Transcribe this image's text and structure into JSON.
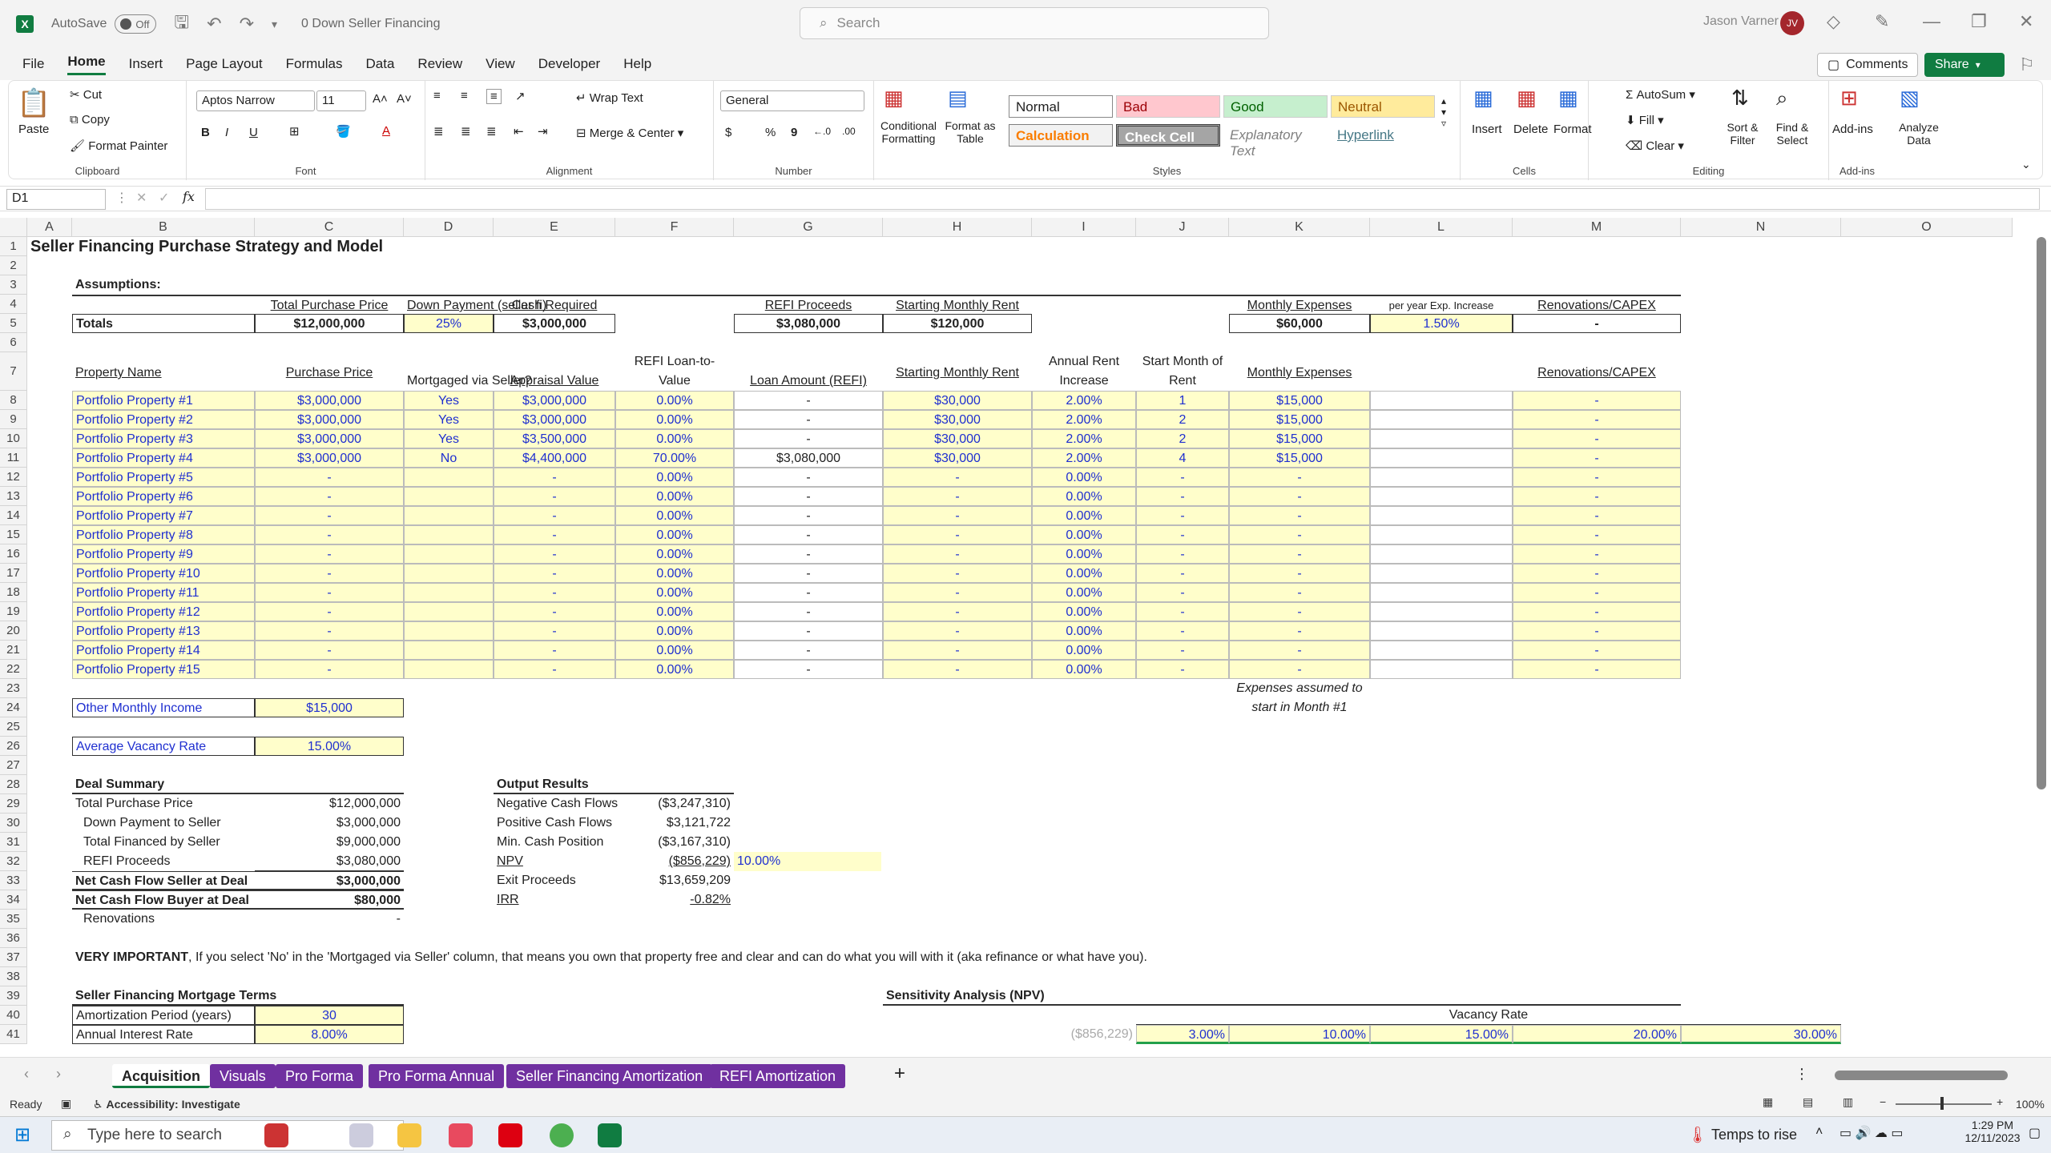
{
  "titlebar": {
    "autosave": "AutoSave",
    "autosave_state": "Off",
    "doc_title": "0 Down Seller Financing",
    "search_placeholder": "Search",
    "user": "Jason Varner",
    "initials": "JV"
  },
  "menu": [
    "File",
    "Home",
    "Insert",
    "Page Layout",
    "Formulas",
    "Data",
    "Review",
    "View",
    "Developer",
    "Help"
  ],
  "menu_right": {
    "comments": "Comments",
    "share": "Share"
  },
  "ribbon": {
    "clipboard": {
      "paste": "Paste",
      "cut": "Cut",
      "copy": "Copy",
      "format_painter": "Format Painter",
      "label": "Clipboard"
    },
    "font": {
      "name": "Aptos Narrow",
      "size": "11",
      "label": "Font",
      "b": "B",
      "i": "I",
      "u": "U"
    },
    "alignment": {
      "wrap": "Wrap Text",
      "merge": "Merge & Center",
      "label": "Alignment"
    },
    "number": {
      "format": "General",
      "label": "Number",
      "currency": "$",
      "pct": "%",
      "comma": "9"
    },
    "styles": {
      "conditional": "Conditional Formatting",
      "format_table": "Format as Table",
      "normal": "Normal",
      "bad": "Bad",
      "good": "Good",
      "neutral": "Neutral",
      "calculation": "Calculation",
      "check_cell": "Check Cell",
      "explanatory": "Explanatory Text",
      "hyperlink": "Hyperlink",
      "label": "Styles"
    },
    "cells": {
      "insert": "Insert",
      "delete": "Delete",
      "format": "Format",
      "label": "Cells"
    },
    "editing": {
      "autosum": "AutoSum",
      "fill": "Fill",
      "clear": "Clear",
      "sort": "Sort & Filter",
      "find": "Find & Select",
      "label": "Editing"
    },
    "addins": {
      "addins": "Add-ins",
      "analyze": "Analyze Data",
      "label": "Add-ins"
    }
  },
  "formula": {
    "namebox": "D1",
    "fx": "fx"
  },
  "columns": [
    "A",
    "B",
    "C",
    "D",
    "E",
    "F",
    "G",
    "H",
    "I",
    "J",
    "K",
    "L",
    "M",
    "N",
    "O"
  ],
  "rows": [
    "1",
    "2",
    "3",
    "4",
    "5",
    "6",
    "7",
    "8",
    "9",
    "10",
    "11",
    "12",
    "13",
    "14",
    "15",
    "16",
    "17",
    "18",
    "19",
    "20",
    "21",
    "22",
    "23",
    "24",
    "25",
    "26",
    "27",
    "28",
    "29",
    "30",
    "31",
    "32",
    "33",
    "34",
    "35",
    "36",
    "37",
    "38",
    "39",
    "40",
    "41"
  ],
  "sheet": {
    "title": "Seller Financing Purchase Strategy and Model",
    "assumptions": "Assumptions:",
    "h4": {
      "tpp": "Total Purchase Price",
      "dp": "Down Payment (seller fi)",
      "cash": "Cash Required",
      "refi": "REFI Proceeds",
      "smr": "Starting Monthly Rent",
      "me": "Monthly Expenses",
      "pyei": "per year Exp. Increase",
      "reno": "Renovations/CAPEX"
    },
    "totals": {
      "label": "Totals",
      "tpp": "$12,000,000",
      "dp": "25%",
      "cash": "$3,000,000",
      "refi": "$3,080,000",
      "smr": "$120,000",
      "me": "$60,000",
      "pyei": "1.50%",
      "reno": "-"
    },
    "h7": {
      "name": "Property Name",
      "pp": "Purchase Price",
      "mort": "Mortgaged via Seller?",
      "appr": "Appraisal Value",
      "ltv1": "REFI Loan-to-",
      "ltv2": "Value",
      "loan": "Loan Amount (REFI)",
      "smr": "Starting Monthly Rent",
      "ari1": "Annual Rent",
      "ari2": "Increase",
      "smo1": "Start Month of",
      "smo2": "Rent",
      "me": "Monthly Expenses",
      "reno": "Renovations/CAPEX"
    },
    "properties": [
      {
        "name": "Portfolio Property #1",
        "pp": "$3,000,000",
        "mort": "Yes",
        "appr": "$3,000,000",
        "ltv": "0.00%",
        "loan": "-",
        "smr": "$30,000",
        "ari": "2.00%",
        "smo": "1",
        "me": "$15,000",
        "reno": "-"
      },
      {
        "name": "Portfolio Property #2",
        "pp": "$3,000,000",
        "mort": "Yes",
        "appr": "$3,000,000",
        "ltv": "0.00%",
        "loan": "-",
        "smr": "$30,000",
        "ari": "2.00%",
        "smo": "2",
        "me": "$15,000",
        "reno": "-"
      },
      {
        "name": "Portfolio Property #3",
        "pp": "$3,000,000",
        "mort": "Yes",
        "appr": "$3,500,000",
        "ltv": "0.00%",
        "loan": "-",
        "smr": "$30,000",
        "ari": "2.00%",
        "smo": "2",
        "me": "$15,000",
        "reno": "-"
      },
      {
        "name": "Portfolio Property #4",
        "pp": "$3,000,000",
        "mort": "No",
        "appr": "$4,400,000",
        "ltv": "70.00%",
        "loan": "$3,080,000",
        "smr": "$30,000",
        "ari": "2.00%",
        "smo": "4",
        "me": "$15,000",
        "reno": "-"
      },
      {
        "name": "Portfolio Property #5",
        "pp": "-",
        "mort": "",
        "appr": "-",
        "ltv": "0.00%",
        "loan": "-",
        "smr": "-",
        "ari": "0.00%",
        "smo": "-",
        "me": "-",
        "reno": "-"
      },
      {
        "name": "Portfolio Property #6",
        "pp": "-",
        "mort": "",
        "appr": "-",
        "ltv": "0.00%",
        "loan": "-",
        "smr": "-",
        "ari": "0.00%",
        "smo": "-",
        "me": "-",
        "reno": "-"
      },
      {
        "name": "Portfolio Property #7",
        "pp": "-",
        "mort": "",
        "appr": "-",
        "ltv": "0.00%",
        "loan": "-",
        "smr": "-",
        "ari": "0.00%",
        "smo": "-",
        "me": "-",
        "reno": "-"
      },
      {
        "name": "Portfolio Property #8",
        "pp": "-",
        "mort": "",
        "appr": "-",
        "ltv": "0.00%",
        "loan": "-",
        "smr": "-",
        "ari": "0.00%",
        "smo": "-",
        "me": "-",
        "reno": "-"
      },
      {
        "name": "Portfolio Property #9",
        "pp": "-",
        "mort": "",
        "appr": "-",
        "ltv": "0.00%",
        "loan": "-",
        "smr": "-",
        "ari": "0.00%",
        "smo": "-",
        "me": "-",
        "reno": "-"
      },
      {
        "name": "Portfolio Property #10",
        "pp": "-",
        "mort": "",
        "appr": "-",
        "ltv": "0.00%",
        "loan": "-",
        "smr": "-",
        "ari": "0.00%",
        "smo": "-",
        "me": "-",
        "reno": "-"
      },
      {
        "name": "Portfolio Property #11",
        "pp": "-",
        "mort": "",
        "appr": "-",
        "ltv": "0.00%",
        "loan": "-",
        "smr": "-",
        "ari": "0.00%",
        "smo": "-",
        "me": "-",
        "reno": "-"
      },
      {
        "name": "Portfolio Property #12",
        "pp": "-",
        "mort": "",
        "appr": "-",
        "ltv": "0.00%",
        "loan": "-",
        "smr": "-",
        "ari": "0.00%",
        "smo": "-",
        "me": "-",
        "reno": "-"
      },
      {
        "name": "Portfolio Property #13",
        "pp": "-",
        "mort": "",
        "appr": "-",
        "ltv": "0.00%",
        "loan": "-",
        "smr": "-",
        "ari": "0.00%",
        "smo": "-",
        "me": "-",
        "reno": "-"
      },
      {
        "name": "Portfolio Property #14",
        "pp": "-",
        "mort": "",
        "appr": "-",
        "ltv": "0.00%",
        "loan": "-",
        "smr": "-",
        "ari": "0.00%",
        "smo": "-",
        "me": "-",
        "reno": "-"
      },
      {
        "name": "Portfolio Property #15",
        "pp": "-",
        "mort": "",
        "appr": "-",
        "ltv": "0.00%",
        "loan": "-",
        "smr": "-",
        "ari": "0.00%",
        "smo": "-",
        "me": "-",
        "reno": "-"
      }
    ],
    "exp_note1": "Expenses assumed to",
    "exp_note2": "start in Month #1",
    "other_income": {
      "label": "Other Monthly Income",
      "value": "$15,000"
    },
    "vacancy": {
      "label": "Average Vacancy Rate",
      "value": "15.00%"
    },
    "deal_summary": {
      "title": "Deal Summary",
      "rows": [
        {
          "label": "Total Purchase Price",
          "value": "$12,000,000"
        },
        {
          "label": "Down Payment to Seller",
          "value": "$3,000,000"
        },
        {
          "label": "Total Financed by Seller",
          "value": "$9,000,000"
        },
        {
          "label": "REFI Proceeds",
          "value": "$3,080,000"
        },
        {
          "label": "Net Cash Flow Seller at Deal",
          "value": "$3,000,000"
        },
        {
          "label": "Net Cash Flow Buyer at Deal",
          "value": "$80,000"
        },
        {
          "label": "Renovations",
          "value": "-"
        }
      ]
    },
    "output": {
      "title": "Output Results",
      "rows": [
        {
          "label": "Negative Cash Flows",
          "value": "($3,247,310)"
        },
        {
          "label": "Positive Cash Flows",
          "value": "$3,121,722"
        },
        {
          "label": "Min. Cash Position",
          "value": "($3,167,310)"
        },
        {
          "label": "NPV",
          "value": "($856,229)"
        },
        {
          "label": "Exit Proceeds",
          "value": "$13,659,209"
        },
        {
          "label": "IRR",
          "value": "-0.82%"
        }
      ],
      "npv_rate": "10.00%"
    },
    "important_bold": "VERY IMPORTANT",
    "important_text": ", If you select 'No' in the 'Mortgaged via Seller' column, that means you own that property free and clear and can do what you will with it (aka refinance or what have you).",
    "mortgage_terms": {
      "title": "Seller Financing Mortgage Terms",
      "amort_label": "Amortization Period (years)",
      "amort": "30",
      "rate_label": "Annual Interest Rate",
      "rate": "8.00%"
    },
    "sensitivity": {
      "title": "Sensitivity Analysis (NPV)",
      "vacancy_label": "Vacancy Rate",
      "base": "($856,229)",
      "rates": [
        "3.00%",
        "10.00%",
        "15.00%",
        "20.00%",
        "30.00%"
      ]
    }
  },
  "tabs": [
    "Acquisition",
    "Visuals",
    "Pro Forma",
    "Pro Forma Annual",
    "Seller Financing Amortization",
    "REFI Amortization"
  ],
  "status": {
    "ready": "Ready",
    "accessibility": "Accessibility: Investigate",
    "zoom": "100%"
  },
  "taskbar": {
    "search": "Type here to search",
    "weather": "Temps to rise",
    "time": "1:29 PM",
    "date": "12/11/2023"
  }
}
